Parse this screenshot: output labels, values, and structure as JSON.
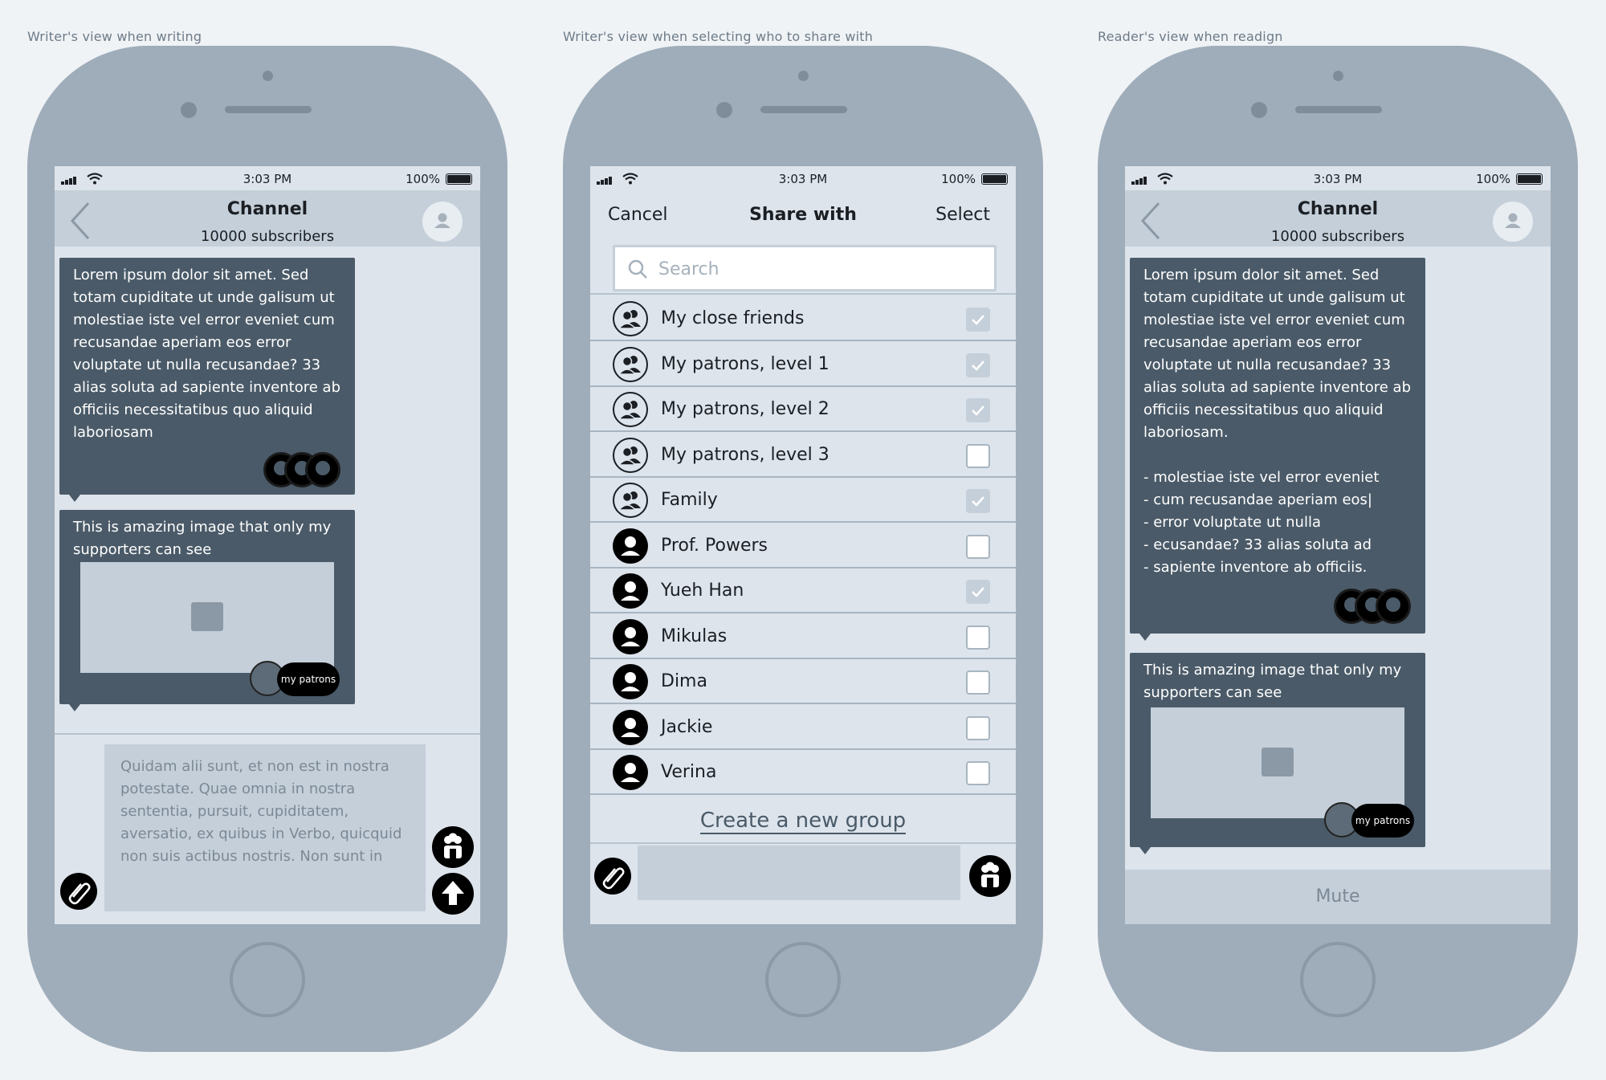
{
  "captions": [
    "Writer's view when writing",
    "Writer's view when selecting who to share with",
    "Reader's view when readign"
  ],
  "status": {
    "time": "3:03 PM",
    "battery": "100%"
  },
  "channel": {
    "title": "Channel",
    "subscribers": "10000 subscribers"
  },
  "writer": {
    "post_text": "Lorem ipsum dolor sit amet. Sed totam cupiditate ut unde galisum ut molestiae iste vel error eveniet cum recusandae aperiam eos error voluptate ut nulla recusandae? 33 alias soluta ad sapiente inventore ab officiis necessitatibus quo aliquid laboriosam",
    "image_caption": "This is amazing image that only my supporters can see",
    "patron_tag": "my patrons",
    "composer_text": "Quidam alii sunt, et non est in nostra potestate. Quae omnia in nostra sententia, pursuit, cupiditatem, aversatio, ex quibus in Verbo, quicquid non suis actibus nostris. Non sunt in"
  },
  "share": {
    "cancel": "Cancel",
    "title": "Share with",
    "select": "Select",
    "search_placeholder": "Search",
    "items": [
      {
        "label": "My close friends",
        "type": "group",
        "checked": true
      },
      {
        "label": "My patrons, level 1",
        "type": "group",
        "checked": true
      },
      {
        "label": "My patrons, level 2",
        "type": "group",
        "checked": true
      },
      {
        "label": "My patrons, level 3",
        "type": "group",
        "checked": false
      },
      {
        "label": "Family",
        "type": "group",
        "checked": true
      },
      {
        "label": "Prof. Powers",
        "type": "person",
        "checked": false
      },
      {
        "label": "Yueh Han",
        "type": "person",
        "checked": true
      },
      {
        "label": "Mikulas",
        "type": "person",
        "checked": false
      },
      {
        "label": "Dima",
        "type": "person",
        "checked": false
      },
      {
        "label": "Jackie",
        "type": "person",
        "checked": false
      },
      {
        "label": "Verina",
        "type": "person",
        "checked": false
      }
    ],
    "create_group": "Create a new group"
  },
  "reader": {
    "post_text": "Lorem ipsum dolor sit amet. Sed totam cupiditate ut unde galisum ut molestiae iste vel error eveniet cum recusandae aperiam eos error voluptate ut nulla recusandae? 33 alias soluta ad sapiente inventore ab officiis necessitatibus quo aliquid laboriosam.",
    "bullets": [
      "-  molestiae iste vel error eveniet",
      "- cum recusandae aperiam eos|",
      "- error voluptate ut nulla",
      "- ecusandae? 33 alias soluta ad",
      "- sapiente inventore ab officiis."
    ],
    "image_caption": "This is amazing image that only my supporters can see",
    "patron_tag": "my patrons",
    "mute": "Mute"
  }
}
